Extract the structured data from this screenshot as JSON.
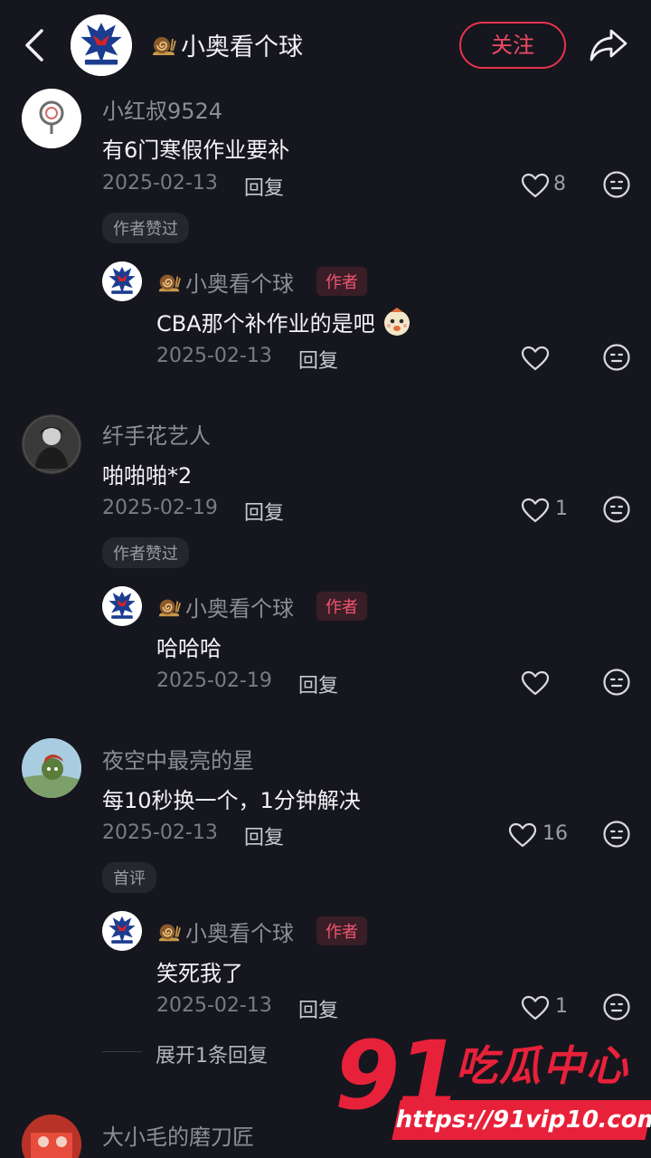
{
  "header": {
    "channel_name": "小奥看个球",
    "follow_label": "关注"
  },
  "icons": {
    "back": "chevron-left-icon",
    "share": "share-arrow-icon",
    "like": "heart-outline-icon",
    "dislike": "meh-face-icon",
    "snail": "snail-emoji",
    "emoji": "ghost-emoji"
  },
  "colors": {
    "background": "#16161e",
    "accent": "#e9334d",
    "watermark": "#e8213a"
  },
  "comments": [
    {
      "username": "小红叔9524",
      "text": "有6门寒假作业要补",
      "date": "2025-02-13",
      "reply_label": "回复",
      "likes": "8",
      "chip": "作者赞过",
      "reply": {
        "username": "小奥看个球",
        "tag": "作者",
        "text": "CBA那个补作业的是吧",
        "date": "2025-02-13",
        "reply_label": "回复",
        "likes": ""
      }
    },
    {
      "username": "纤手花艺人",
      "text": "啪啪啪*2",
      "date": "2025-02-19",
      "reply_label": "回复",
      "likes": "1",
      "chip": "作者赞过",
      "reply": {
        "username": "小奥看个球",
        "tag": "作者",
        "text": "哈哈哈",
        "date": "2025-02-19",
        "reply_label": "回复",
        "likes": ""
      }
    },
    {
      "username": "夜空中最亮的星",
      "text": "每10秒换一个，1分钟解决",
      "date": "2025-02-13",
      "reply_label": "回复",
      "likes": "16",
      "chip": "首评",
      "reply": {
        "username": "小奥看个球",
        "tag": "作者",
        "text": "笑死我了",
        "date": "2025-02-13",
        "reply_label": "回复",
        "likes": "1"
      },
      "expand_label": "展开1条回复"
    },
    {
      "username": "大小毛的磨刀匠"
    }
  ],
  "watermark": {
    "number": "91",
    "brand": "吃瓜中心",
    "url": "https://91vip10.com"
  }
}
